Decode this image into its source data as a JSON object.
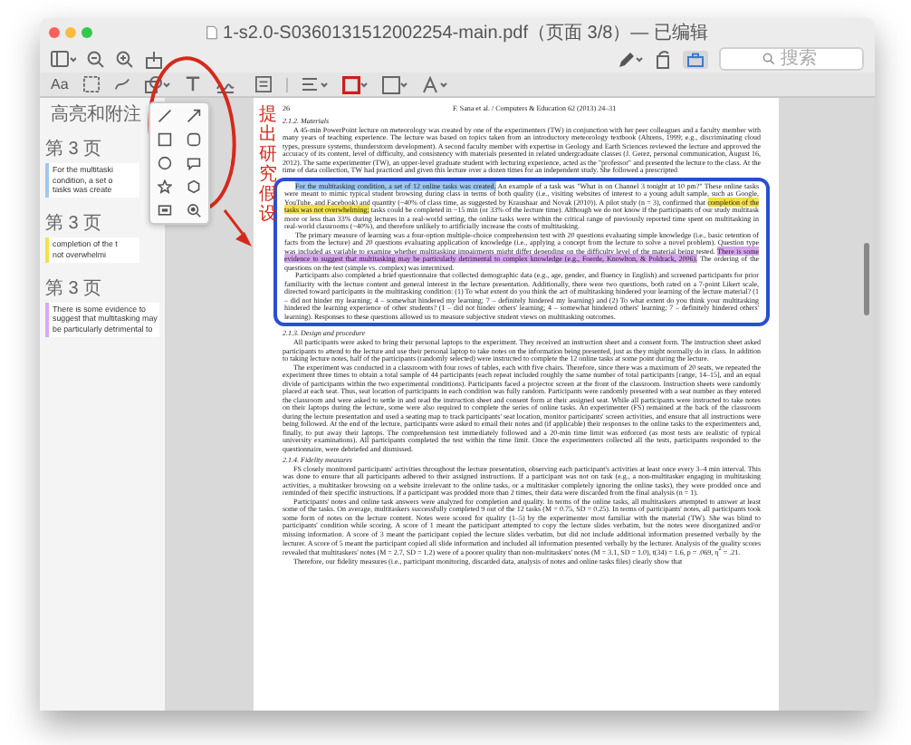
{
  "window": {
    "title": "1-s2.0-S0360131512002254-main.pdf（页面 3/8）— 已编辑"
  },
  "search": {
    "placeholder": "搜索"
  },
  "markup_toolbar": {
    "text_style": "Aa"
  },
  "sidebar": {
    "title": "高亮和附注",
    "notes": [
      {
        "page": "第 3 页",
        "color": "#9fc8f0",
        "lines": [
          "For the multitaski",
          "condition, a set o",
          "tasks was create"
        ]
      },
      {
        "page": "第 3 页",
        "color": "#f3e14a",
        "lines": [
          "completion of the t",
          "not overwhelmi"
        ]
      },
      {
        "page": "第 3 页",
        "color": "#d8a8f0",
        "lines": [
          "There is some evidence to",
          "suggest that multitasking may",
          "be particularly detrimental to"
        ]
      }
    ]
  },
  "margin_note": "提出研究假设",
  "document": {
    "page_number": "26",
    "running_head": "F. Sana et al. / Computers & Education 62 (2013) 24–31",
    "blocks": [
      {
        "kind": "heading",
        "runs": [
          {
            "text": "2.1.2. Materials"
          }
        ]
      },
      {
        "kind": "paragraph",
        "boxed": false,
        "runs": [
          {
            "text": "A 45-min PowerPoint lecture on meteorology was created by one of the experimenters (TW) in conjunction with her peer colleagues and a faculty member with many years of teaching experience. The lecture was based on topics taken from an introductory meteorology textbook (Ahrens, 1999; e.g., discriminating cloud types, pressure systems, thunderstorm development). A second faculty member with expertise in Geology and Earth Sciences reviewed the lecture and approved the accuracy of its content, level of difficulty, and consistency with materials presented in related undergraduate classes (J. Gerez, personal communication, August 16, 2012). The same experimenter (TW), an upper-level graduate student with lecturing experience, acted as the \"professor\" and presented the lecture to the class. At the time of data collection, TW had practiced and given this lecture over a dozen times for an independent study. She followed a prescripted"
          }
        ]
      },
      {
        "kind": "paragraph",
        "boxed": true,
        "runs": [
          {
            "text": "For the multitasking condition, a set of 12 online tasks was created.",
            "color": "#9fc8f0"
          },
          {
            "text": " An example of a task was \"What is on Channel 3 tonight at 10 pm?\" These online tasks were meant to mimic typical student browsing during class in terms of both quality (i.e., visiting websites of interest to a young adult sample, such as Google, YouTube, and Facebook) and quantity (~40% of class time, as suggested by Kraushaar and Novak (2010)). A pilot study (n = 3), confirmed that "
          },
          {
            "text": "completion of the tasks was not overwhelming;",
            "color": "#f3e14a"
          },
          {
            "text": " tasks could be completed in ~15 min (or 33% of the lecture time). Although we do not know if the participants of our study multitask more or less than 33% during lectures in a real-world setting, the online tasks were within the critical range of previously reported time spent on multitasking in real-world classrooms (~40%), and therefore unlikely to artificially increase the costs of multitasking."
          }
        ]
      },
      {
        "kind": "paragraph",
        "boxed": true,
        "runs": [
          {
            "text": "The primary measure of learning was a four-option multiple-choice comprehension test with 20 questions evaluating simple knowledge (i.e., basic retention of facts from the lecture) and 20 questions evaluating application of knowledge (i.e., applying a concept from the lecture to solve a novel problem). Question type was included as variable to examine whether multitasking impairments might differ depending on the difficulty level of the material being tested. "
          },
          {
            "text": "There is some evidence to suggest that multitasking may be particularly detrimental to complex knowledge (e.g., Foerde, Knowlton, & Poldrack, 2006).",
            "color": "#d8a8f0"
          },
          {
            "text": " The ordering of the questions on the test (simple vs. complex) was intermixed."
          }
        ]
      },
      {
        "kind": "paragraph",
        "boxed": true,
        "runs": [
          {
            "text": "Participants also completed a brief questionnaire that collected demographic data (e.g., age, gender, and fluency in English) and screened participants for prior familiarity with the lecture content and general interest in the lecture presentation. Additionally, there were two questions, both rated on a 7-point Likert scale, directed toward participants in the multitasking condition: (1) To what extent do you think the act of multitasking hindered your learning of the lecture material? (1 – did not hinder my learning; 4 – somewhat hindered my learning; 7 – definitely hindered my learning) and (2) To what extent do you think your multitasking hindered the learning experience of other students? (1 – did not hinder others' learning; 4 – somewhat hindered others' learning; 7 – definitely hindered others' learning). Responses to these questions allowed us to measure subjective student views on multitasking outcomes."
          }
        ]
      },
      {
        "kind": "heading",
        "runs": [
          {
            "text": "2.1.3. Design and procedure"
          }
        ]
      },
      {
        "kind": "paragraph",
        "boxed": false,
        "runs": [
          {
            "text": "All participants were asked to bring their personal laptops to the experiment. They received an instruction sheet and a consent form. The instruction sheet asked participants to attend to the lecture and use their personal laptop to take notes on the information being presented, just as they might normally do in class. In addition to taking lecture notes, half of the participants (randomly selected) were instructed to complete the 12 online tasks at some point during the lecture."
          }
        ]
      },
      {
        "kind": "paragraph",
        "boxed": false,
        "runs": [
          {
            "text": "The experiment was conducted in a classroom with four rows of tables, each with five chairs. Therefore, since there was a maximum of 20 seats, we repeated the experiment three times to obtain a total sample of 44 participants (each repeat included roughly the same number of total participants [range, 14–15], and an equal divide of participants within the two experimental conditions). Participants faced a projector screen at the front of the classroom. Instruction sheets were randomly placed at each seat. Thus, seat location of participants in each condition was fully random. Participants were randomly presented with a seat number as they entered the classroom and were asked to settle in and read the instruction sheet and consent form at their assigned seat. While all participants were instructed to take notes on their laptops during the lecture, some were also required to complete the series of online tasks. An experimenter (FS) remained at the back of the classroom during the lecture presentation and used a seating map to track participants' seat location, monitor participants' screen activities, and ensure that all instructions were being followed. At the end of the lecture, participants were asked to email their notes and (if applicable) their responses to the online tasks to the experimenters and, finally, to put away their laptops. The comprehension test immediately followed and a 20-min time limit was enforced (as most tests are realistic of typical university examinations). All participants completed the test within the time limit. Once the experimenters collected all the tests, participants responded to the questionnaire, were debriefed and dismissed."
          }
        ]
      },
      {
        "kind": "heading",
        "runs": [
          {
            "text": "2.1.4. Fidelity measures"
          }
        ]
      },
      {
        "kind": "paragraph",
        "boxed": false,
        "runs": [
          {
            "text": "FS closely monitored participants' activities throughout the lecture presentation, observing each participant's activities at least once every 3–4 min interval. This was done to ensure that all participants adhered to their assigned instructions. If a participant was not on task (e.g., a non-multitasker engaging in multitasking activities, a multitasker browsing on a website irrelevant to the online tasks, or a multitasker completely ignoring the online tasks), they were prodded once and reminded of their specific instructions. If a participant was prodded more than 2 times, their data were discarded from the final analysis (n = 1)."
          }
        ]
      },
      {
        "kind": "paragraph",
        "boxed": false,
        "runs": [
          {
            "text": "Participants' notes and online task answers were analyzed for completion and quality. In terms of the online tasks, all multitaskers attempted to answer at least some of the tasks. On average, multitaskers successfully completed 9 out of the 12 tasks (M = 0.75, SD = 0.25). In terms of participants' notes, all participants took some form of notes on the lecture content. Notes were scored for quality (1–5) by the experimenter most familiar with the material (TW). She was blind to participants' condition while scoring. A score of 1 meant the participant attempted to copy the lecture slides verbatim, but the notes were disorganized and/or missing information. A score of 3 meant the participant copied the lecture slides verbatim, but did not include additional information presented verbally by the lecturer. A score of 5 meant the participant copied all slide information and included all information presented verbally by the lecturer. Analysis of the quality scores revealed that multitaskers' notes (M = 2.7, SD = 1.2) were of a poorer quality than non-multitaskers' notes (M = 3.1, SD = 1.0), t(34) = 1.6, p = .069, η$^{2}$ = .21."
          }
        ]
      },
      {
        "kind": "paragraph",
        "boxed": false,
        "runs": [
          {
            "text": "Therefore, our fidelity measures (i.e., participant monitoring, discarded data, analysis of notes and online tasks files) clearly show that"
          }
        ]
      }
    ]
  }
}
